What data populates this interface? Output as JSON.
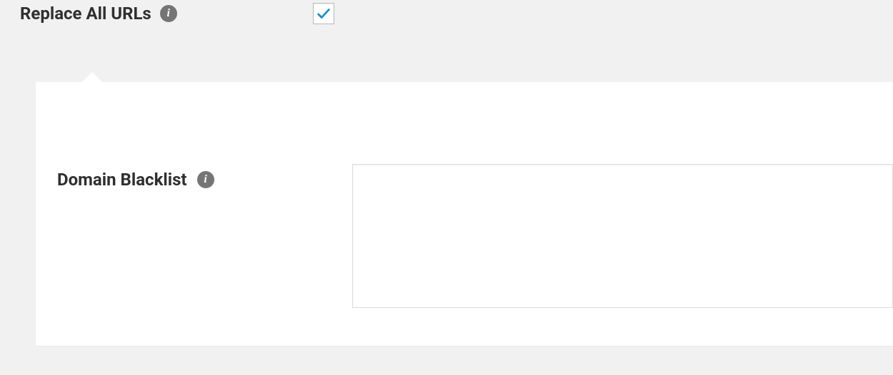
{
  "top": {
    "replace_all_urls_label": "Replace All URLs",
    "replace_all_urls_checked": true
  },
  "panel": {
    "domain_blacklist_label": "Domain Blacklist",
    "domain_blacklist_value": ""
  },
  "icons": {
    "info_glyph": "i"
  }
}
